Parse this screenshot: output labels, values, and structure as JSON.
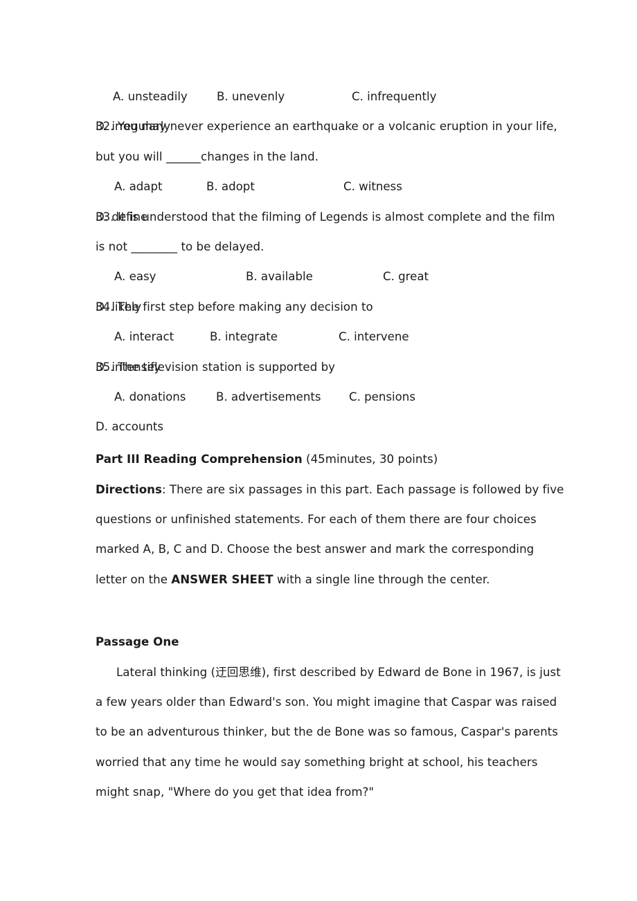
{
  "document": {
    "questions": [
      {
        "id": "q31-options",
        "options_only": true,
        "options": [
          "A. unsteadily",
          "B. unevenly",
          "C. infrequently",
          "D. irregularly"
        ],
        "columns": "25px 150px 195px 154px"
      },
      {
        "id": "q32",
        "number": "32.",
        "stem_lines": [
          "32. You may never experience an earthquake or a volcanic eruption in your life,",
          "but you will ______changes in the land."
        ],
        "stem_line1_text": "32. You may never experience an earthquake or a volcanic eruption in your life,",
        "stem_line2_prefix": "but you will ",
        "stem_line2_blank": "______",
        "stem_line2_suffix": "changes in the land.",
        "options": [
          "A. adapt",
          "B. adopt",
          "C. witness",
          "D. define"
        ],
        "columns": "27px 133px 198px 130px"
      },
      {
        "id": "q33",
        "stem_line1_text": "33. It is understood that the filming of Legends is almost complete and the film",
        "stem_line2_prefix": "is not ",
        "stem_line2_blank": "________",
        "stem_line2_suffix": " to be delayed.",
        "options": [
          "A. easy",
          "B. available",
          "C. great",
          "D. likely"
        ],
        "columns": "27px 190px 198px 159px"
      },
      {
        "id": "q34",
        "stem_line1_text": "34. The first step before making any decision to",
        "options": [
          "A. interact",
          "B. integrate",
          "C. intervene",
          "D. intensify"
        ],
        "columns": "27px 138px 186px 144px"
      },
      {
        "id": "q35",
        "stem_line1_text": "35. The television station is supported by",
        "options": [
          "A. donations",
          "B. advertisements",
          "C. pensions",
          "D. accounts"
        ],
        "columns": "27px 147px 192px 140px"
      }
    ],
    "part_three": {
      "heading_bold": "Part III Reading Comprehension",
      "heading_rest": " (45minutes, 30 points)",
      "directions_label": "Directions",
      "directions_line1_after_label": ": There are six passages in this part. Each passage is followed by five",
      "directions_line2": "questions or unfinished statements. For each of them there are four choices",
      "directions_line3": "marked A, B, C and D. Choose the best answer and mark the corresponding",
      "directions_line4_prefix": "letter on the ",
      "directions_line4_bold": "ANSWER SHEET",
      "directions_line4_suffix": " with a single line through the center."
    },
    "passage_one": {
      "heading": "Passage One",
      "line1_prefix": "Lateral thinking (",
      "line1_cjk": "迂回思维",
      "line1_suffix": "), first described by Edward de Bone in 1967, is just",
      "line2": "a few years older than Edward's son. You might imagine that Caspar was raised",
      "line3": "to be an adventurous thinker, but the de Bone was so famous, Caspar's parents",
      "line4": "worried that any time he would say something bright at school, his teachers",
      "line5": "might snap, \"Where do you get that idea from?\""
    }
  }
}
